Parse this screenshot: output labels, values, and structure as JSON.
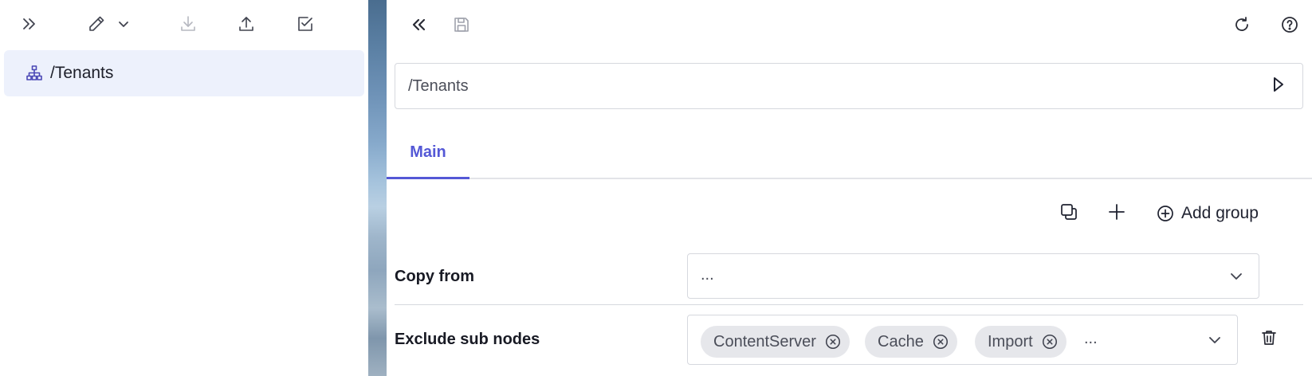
{
  "left": {
    "toolbar": {
      "expand_icon": "double-chevron-right-icon",
      "edit_icon": "pencil-icon",
      "edit_menu_icon": "chevron-down-icon",
      "download_icon": "download-icon",
      "upload_icon": "upload-icon",
      "check_icon": "checkbox-icon"
    },
    "tree": {
      "items": [
        {
          "icon": "hierarchy-icon",
          "label": "/Tenants",
          "selected": true
        }
      ]
    }
  },
  "right": {
    "toolbar": {
      "collapse_icon": "double-chevron-left-icon",
      "save_icon": "save-icon",
      "refresh_icon": "refresh-icon",
      "help_icon": "help-icon"
    },
    "path": {
      "value": "/Tenants",
      "run_icon": "play-icon"
    },
    "tabs": [
      {
        "label": "Main",
        "active": true
      }
    ],
    "group_actions": {
      "copy_icon": "copy-icon",
      "add_icon": "plus-icon",
      "add_group_label": "Add group"
    },
    "fields": {
      "copy_from": {
        "label": "Copy from",
        "value": "..."
      },
      "exclude_sub_nodes": {
        "label": "Exclude sub nodes",
        "chips": [
          "ContentServer",
          "Cache",
          "Import"
        ],
        "more": "...",
        "delete_icon": "trash-icon"
      }
    }
  },
  "colors": {
    "accent": "#5458d6",
    "selected_bg": "#edf1fc",
    "chip_bg": "#e6e7eb",
    "border": "#d6d8de"
  }
}
